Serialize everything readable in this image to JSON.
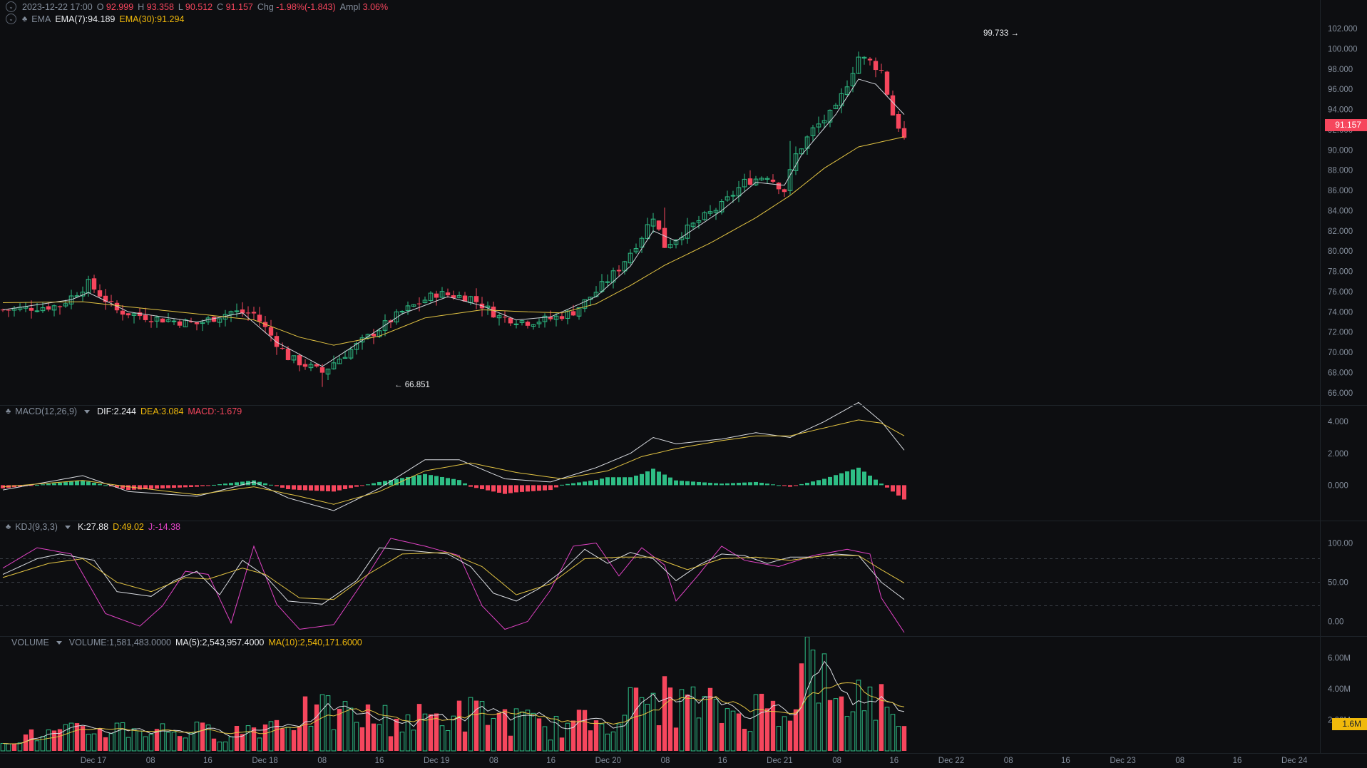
{
  "main_legend": {
    "datetime": "2023-12-22 17:00",
    "o_label": "O",
    "o_value": "92.999",
    "h_label": "H",
    "h_value": "93.358",
    "l_label": "L",
    "l_value": "90.512",
    "c_label": "C",
    "c_value": "91.157",
    "chg_label": "Chg",
    "chg_value": "-1.98%(-1.843)",
    "ampl_label": "Ampl",
    "ampl_value": "3.06%"
  },
  "ema_legend": {
    "name": "EMA",
    "ema7": "EMA(7):94.189",
    "ema30": "EMA(30):91.294"
  },
  "macd_legend": {
    "name": "MACD(12,26,9)",
    "dif": "DIF:2.244",
    "dea": "DEA:3.084",
    "macd": "MACD:-1.679"
  },
  "kdj_legend": {
    "name": "KDJ(9,3,3)",
    "k": "K:27.88",
    "d": "D:49.02",
    "j": "J:-14.38"
  },
  "volume_legend": {
    "name": "VOLUME",
    "volume": "VOLUME:1,581,483.0000",
    "ma5": "MA(5):2,543,957.4000",
    "ma10": "MA(10):2,540,171.6000"
  },
  "price_tags": {
    "last_price": "91.157",
    "last_volume": "1.6M"
  },
  "annotations": {
    "high": "99.733",
    "low": "66.851",
    "high_arrow": "→",
    "low_arrow": "←"
  },
  "colors": {
    "up": "#2ebd85",
    "down": "#f6465d",
    "ema7": "#cfd3da",
    "ema30": "#e3c443",
    "k": "#d9dce1",
    "d": "#e3c443",
    "j": "#e042c4",
    "volume_tag": "#f0b90b"
  },
  "chart_data": {
    "type": "candlestick",
    "price_axis": {
      "ticks": [
        "102.000",
        "100.000",
        "98.000",
        "96.000",
        "94.000",
        "92.000",
        "90.000",
        "88.000",
        "86.000",
        "84.000",
        "82.000",
        "80.000",
        "78.000",
        "76.000",
        "74.000",
        "72.000",
        "70.000",
        "68.000",
        "66.000"
      ],
      "range": [
        65,
        102
      ]
    },
    "macd_axis": {
      "ticks": [
        "4.000",
        "2.000",
        "0.000"
      ],
      "range": [
        -2.0,
        4.5
      ]
    },
    "kdj_axis": {
      "ticks": [
        "100.00",
        "50.00",
        "0.00"
      ],
      "range": [
        -15,
        115
      ]
    },
    "volume_axis": {
      "ticks": [
        "6.00M",
        "4.00M",
        "2.00M"
      ],
      "range": [
        0,
        6.8
      ]
    },
    "time_axis": [
      "Dec 17",
      "08",
      "16",
      "Dec 18",
      "08",
      "16",
      "Dec 19",
      "08",
      "16",
      "Dec 20",
      "08",
      "16",
      "Dec 21",
      "08",
      "16",
      "Dec 22",
      "08",
      "16",
      "Dec 23",
      "08",
      "16",
      "Dec 24"
    ],
    "price_keypoints": [
      [
        0,
        74.2
      ],
      [
        10,
        74.6
      ],
      [
        15,
        76.8
      ],
      [
        20,
        74.1
      ],
      [
        26,
        73.4
      ],
      [
        34,
        72.8
      ],
      [
        40,
        74.0
      ],
      [
        44,
        73.8
      ],
      [
        50,
        69.5
      ],
      [
        56,
        68.0
      ],
      [
        58,
        69.0
      ],
      [
        64,
        71.5
      ],
      [
        70,
        74.0
      ],
      [
        76,
        75.8
      ],
      [
        82,
        75.4
      ],
      [
        87,
        73.5
      ],
      [
        92,
        73.0
      ],
      [
        96,
        73.3
      ],
      [
        100,
        74.0
      ],
      [
        104,
        76.0
      ],
      [
        108,
        78.3
      ],
      [
        112,
        81.5
      ],
      [
        114,
        83.5
      ],
      [
        116,
        80.5
      ],
      [
        122,
        83.0
      ],
      [
        126,
        84.5
      ],
      [
        130,
        86.8
      ],
      [
        134,
        87.5
      ],
      [
        137,
        86.0
      ],
      [
        139,
        89.5
      ],
      [
        142,
        92.0
      ],
      [
        146,
        94.0
      ],
      [
        150,
        99.2
      ],
      [
        152,
        98.7
      ],
      [
        154,
        97.8
      ],
      [
        156,
        93.5
      ],
      [
        158,
        91.2
      ]
    ],
    "ema7_keypoints": [
      [
        0,
        74.2
      ],
      [
        12,
        75.2
      ],
      [
        15,
        75.9
      ],
      [
        22,
        74.0
      ],
      [
        34,
        73.0
      ],
      [
        42,
        73.9
      ],
      [
        48,
        71.0
      ],
      [
        56,
        68.6
      ],
      [
        62,
        70.8
      ],
      [
        70,
        73.8
      ],
      [
        78,
        75.5
      ],
      [
        84,
        74.6
      ],
      [
        90,
        73.2
      ],
      [
        96,
        73.5
      ],
      [
        104,
        75.5
      ],
      [
        110,
        78.5
      ],
      [
        114,
        82.0
      ],
      [
        118,
        81.0
      ],
      [
        126,
        84.0
      ],
      [
        132,
        86.8
      ],
      [
        137,
        86.5
      ],
      [
        140,
        89.5
      ],
      [
        146,
        93.5
      ],
      [
        150,
        97.0
      ],
      [
        153,
        96.5
      ],
      [
        158,
        93.5
      ]
    ],
    "ema30_keypoints": [
      [
        0,
        74.9
      ],
      [
        14,
        75.0
      ],
      [
        22,
        74.5
      ],
      [
        34,
        73.8
      ],
      [
        44,
        73.2
      ],
      [
        52,
        71.5
      ],
      [
        58,
        70.7
      ],
      [
        66,
        71.6
      ],
      [
        74,
        73.4
      ],
      [
        84,
        74.2
      ],
      [
        92,
        74.0
      ],
      [
        98,
        73.9
      ],
      [
        104,
        74.8
      ],
      [
        110,
        76.6
      ],
      [
        116,
        78.6
      ],
      [
        124,
        80.8
      ],
      [
        132,
        83.3
      ],
      [
        138,
        85.5
      ],
      [
        144,
        88.2
      ],
      [
        150,
        90.3
      ],
      [
        158,
        91.3
      ]
    ],
    "dif_keypoints": [
      [
        0,
        -0.3
      ],
      [
        14,
        0.6
      ],
      [
        22,
        -0.4
      ],
      [
        34,
        -0.7
      ],
      [
        44,
        0.2
      ],
      [
        50,
        -0.8
      ],
      [
        58,
        -1.6
      ],
      [
        66,
        -0.2
      ],
      [
        74,
        1.6
      ],
      [
        80,
        1.6
      ],
      [
        88,
        0.4
      ],
      [
        96,
        0.2
      ],
      [
        104,
        1.1
      ],
      [
        110,
        2.0
      ],
      [
        114,
        3.0
      ],
      [
        118,
        2.6
      ],
      [
        126,
        2.9
      ],
      [
        132,
        3.3
      ],
      [
        138,
        3.0
      ],
      [
        144,
        4.0
      ],
      [
        150,
        5.2
      ],
      [
        154,
        4.0
      ],
      [
        158,
        2.2
      ]
    ],
    "dea_keypoints": [
      [
        0,
        -0.1
      ],
      [
        14,
        0.3
      ],
      [
        22,
        -0.1
      ],
      [
        34,
        -0.6
      ],
      [
        44,
        -0.1
      ],
      [
        52,
        -0.7
      ],
      [
        58,
        -1.2
      ],
      [
        66,
        -0.4
      ],
      [
        74,
        0.9
      ],
      [
        82,
        1.4
      ],
      [
        90,
        0.8
      ],
      [
        98,
        0.4
      ],
      [
        106,
        0.9
      ],
      [
        112,
        1.8
      ],
      [
        118,
        2.3
      ],
      [
        126,
        2.8
      ],
      [
        132,
        3.1
      ],
      [
        138,
        3.1
      ],
      [
        144,
        3.6
      ],
      [
        150,
        4.1
      ],
      [
        154,
        3.9
      ],
      [
        158,
        3.1
      ]
    ],
    "k_keypoints": [
      [
        0,
        60
      ],
      [
        6,
        80
      ],
      [
        10,
        86
      ],
      [
        16,
        78
      ],
      [
        20,
        38
      ],
      [
        26,
        32
      ],
      [
        30,
        52
      ],
      [
        34,
        64
      ],
      [
        38,
        34
      ],
      [
        42,
        78
      ],
      [
        46,
        58
      ],
      [
        50,
        26
      ],
      [
        56,
        22
      ],
      [
        62,
        52
      ],
      [
        66,
        94
      ],
      [
        72,
        90
      ],
      [
        78,
        86
      ],
      [
        82,
        70
      ],
      [
        86,
        36
      ],
      [
        90,
        26
      ],
      [
        94,
        42
      ],
      [
        98,
        64
      ],
      [
        102,
        92
      ],
      [
        106,
        74
      ],
      [
        110,
        88
      ],
      [
        114,
        80
      ],
      [
        118,
        52
      ],
      [
        122,
        72
      ],
      [
        126,
        86
      ],
      [
        130,
        84
      ],
      [
        134,
        74
      ],
      [
        138,
        82
      ],
      [
        142,
        82
      ],
      [
        146,
        86
      ],
      [
        150,
        84
      ],
      [
        154,
        50
      ],
      [
        158,
        28
      ]
    ],
    "d_keypoints": [
      [
        0,
        56
      ],
      [
        8,
        74
      ],
      [
        14,
        80
      ],
      [
        20,
        50
      ],
      [
        26,
        38
      ],
      [
        32,
        56
      ],
      [
        36,
        54
      ],
      [
        42,
        68
      ],
      [
        46,
        60
      ],
      [
        52,
        30
      ],
      [
        58,
        28
      ],
      [
        64,
        60
      ],
      [
        70,
        86
      ],
      [
        78,
        88
      ],
      [
        84,
        70
      ],
      [
        90,
        34
      ],
      [
        96,
        48
      ],
      [
        102,
        80
      ],
      [
        108,
        82
      ],
      [
        114,
        82
      ],
      [
        120,
        66
      ],
      [
        126,
        80
      ],
      [
        132,
        82
      ],
      [
        138,
        78
      ],
      [
        144,
        84
      ],
      [
        150,
        84
      ],
      [
        154,
        66
      ],
      [
        158,
        49
      ]
    ],
    "j_keypoints": [
      [
        0,
        68
      ],
      [
        6,
        94
      ],
      [
        12,
        86
      ],
      [
        18,
        10
      ],
      [
        24,
        -6
      ],
      [
        28,
        20
      ],
      [
        32,
        64
      ],
      [
        36,
        60
      ],
      [
        40,
        -2
      ],
      [
        44,
        96
      ],
      [
        48,
        22
      ],
      [
        52,
        -10
      ],
      [
        58,
        -4
      ],
      [
        64,
        60
      ],
      [
        68,
        106
      ],
      [
        74,
        96
      ],
      [
        80,
        84
      ],
      [
        84,
        20
      ],
      [
        88,
        -10
      ],
      [
        92,
        0
      ],
      [
        96,
        40
      ],
      [
        100,
        96
      ],
      [
        104,
        100
      ],
      [
        108,
        58
      ],
      [
        112,
        94
      ],
      [
        116,
        72
      ],
      [
        118,
        26
      ],
      [
        122,
        60
      ],
      [
        126,
        96
      ],
      [
        130,
        78
      ],
      [
        136,
        70
      ],
      [
        142,
        84
      ],
      [
        148,
        92
      ],
      [
        152,
        86
      ],
      [
        154,
        30
      ],
      [
        158,
        -14
      ]
    ],
    "volume_keypoints": [
      [
        0,
        0.8
      ],
      [
        20,
        1.5
      ],
      [
        40,
        1.2
      ],
      [
        54,
        2.5
      ],
      [
        70,
        2.0
      ],
      [
        84,
        2.5
      ],
      [
        96,
        1.5
      ],
      [
        104,
        2.0
      ],
      [
        114,
        3.5
      ],
      [
        128,
        2.5
      ],
      [
        138,
        3.2
      ],
      [
        142,
        6.5
      ],
      [
        146,
        2.5
      ],
      [
        150,
        3.8
      ],
      [
        154,
        3.4
      ],
      [
        156,
        3.2
      ],
      [
        158,
        1.6
      ]
    ]
  }
}
